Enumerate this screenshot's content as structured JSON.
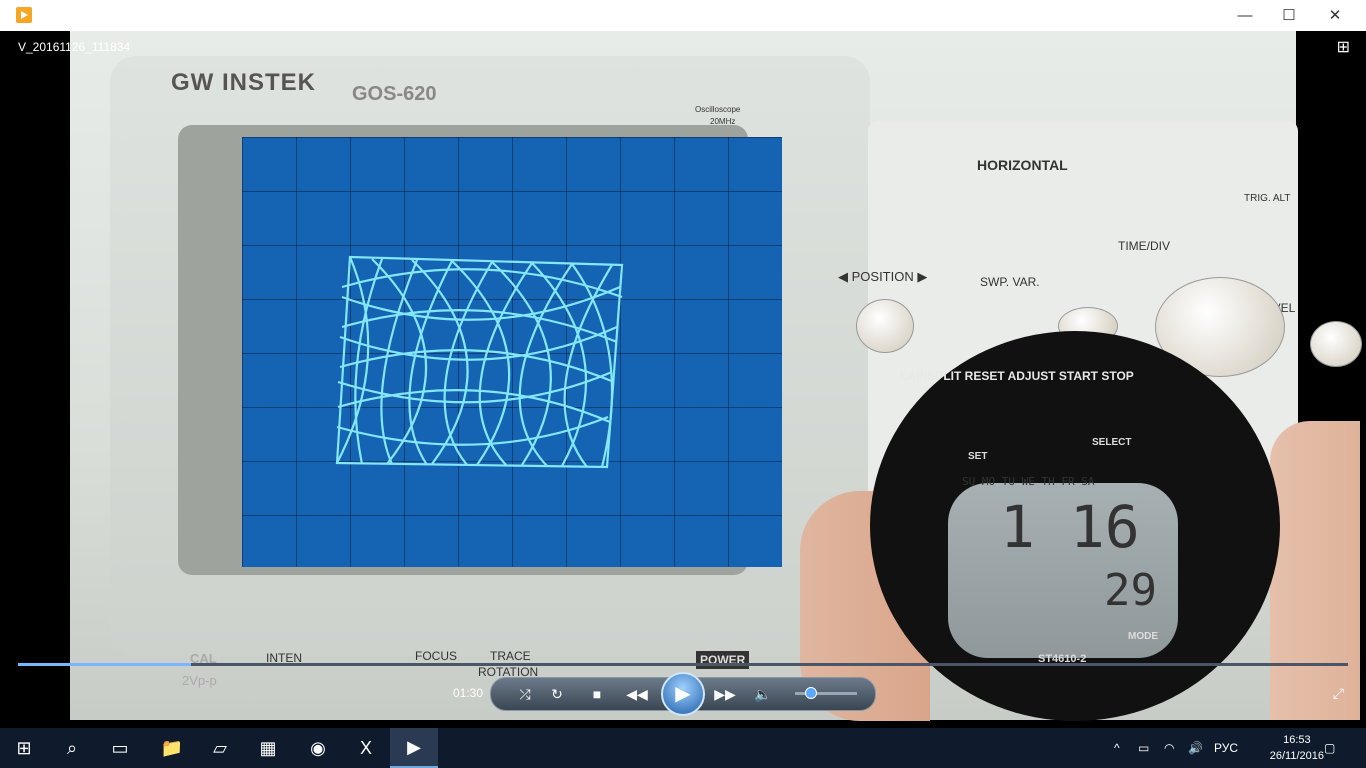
{
  "window": {
    "title": "V_20161126_111834",
    "controls": {
      "minimize": "—",
      "maximize": "☐",
      "close": "✕"
    }
  },
  "video": {
    "brand": "GW INSTEK",
    "model": "GOS-620",
    "scope_caption_1": "Oscilloscope",
    "scope_caption_2": "20MHz",
    "horizontal": "HORIZONTAL",
    "position": "◀ POSITION ▶",
    "swp_var": "SWP. VAR.",
    "time_div": "TIME/DIV",
    "trig_alt": "TRIG. ALT",
    "level": "LEVEL",
    "inten": "INTEN",
    "focus": "FOCUS",
    "trace_rotation_1": "TRACE",
    "trace_rotation_2": "ROTATION",
    "power": "POWER",
    "cal": "CAL",
    "cal_value": "2Vp-p",
    "watch": {
      "top_labels": "LAP/SPLIT RESET   ADJUST   START STOP",
      "set": "SET",
      "select": "SELECT",
      "days": "SU MO TU WE TH FR SA",
      "digits_big": "1 16",
      "digits_small": "29",
      "mode": "MODE",
      "model": "ST4610-2"
    }
  },
  "player": {
    "time": "01:30",
    "progress": 0.13,
    "volume": 0.3,
    "icons": {
      "shuffle": "shuffle-icon",
      "repeat": "repeat-icon",
      "stop": "stop-icon",
      "prev": "rewind-icon",
      "play": "play-icon",
      "next": "fast-forward-icon",
      "volume": "volume-icon",
      "switch_view": "switch-to-library-icon",
      "fullscreen": "fullscreen-icon"
    }
  },
  "taskbar": {
    "apps": [
      "start-icon",
      "search-icon",
      "task-view-icon",
      "file-explorer-icon",
      "notes-icon",
      "calculator-icon",
      "firefox-icon",
      "excel-icon",
      "media-player-icon"
    ],
    "language": "РУС",
    "time": "16:53",
    "date": "26/11/2016"
  }
}
